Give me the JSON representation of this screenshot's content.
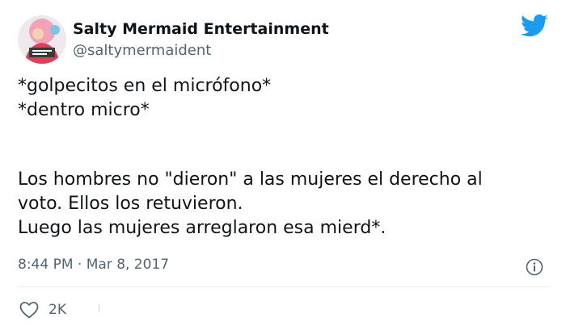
{
  "user": {
    "display_name": "Salty Mermaid Entertainment",
    "handle": "@saltymermaident"
  },
  "brand_icon": "twitter-bird-icon",
  "tweet": {
    "line1": "*golpecitos en el micrófono*",
    "line2": "*dentro micro*",
    "line3": "Los hombres no \"dieron\" a las mujeres el derecho al",
    "line4": "voto. Ellos los retuvieron.",
    "line5": "Luego las mujeres arreglaron esa mierd*."
  },
  "timestamp": "8:44 PM · Mar 8, 2017",
  "actions": {
    "like_icon": "heart-icon",
    "like_count": "2K",
    "info_icon": "info-icon"
  },
  "colors": {
    "text": "#0f1419",
    "secondary": "#536471",
    "accent": "#1d9bf0",
    "divider": "#e6ecf0"
  }
}
